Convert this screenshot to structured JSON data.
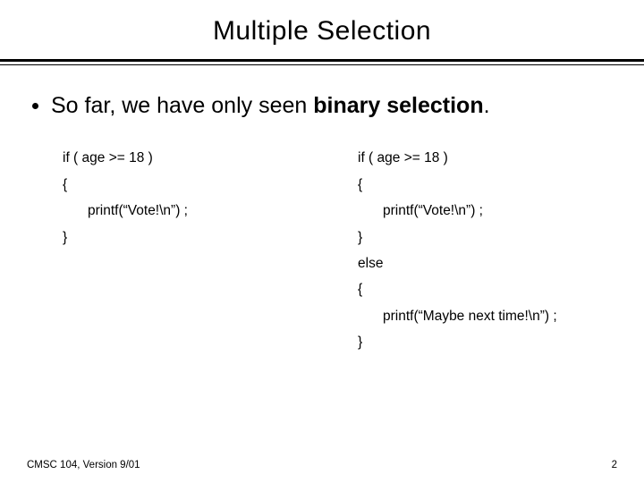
{
  "title": "Multiple Selection",
  "bullet": {
    "prefix": "So far, we have only seen ",
    "bold": "binary selection",
    "suffix": "."
  },
  "left": {
    "l1": "if ( age >= 18 )",
    "l2": "{",
    "l3": "printf(“Vote!\\n”) ;",
    "l4": "}"
  },
  "right": {
    "l1": "if ( age >= 18 )",
    "l2": "{",
    "l3": "printf(“Vote!\\n”) ;",
    "l4": "}",
    "l5": "else",
    "l6": "{",
    "l7": "printf(“Maybe next time!\\n”) ;",
    "l8": "}"
  },
  "footer": {
    "left": "CMSC 104, Version 9/01",
    "right": "2"
  }
}
